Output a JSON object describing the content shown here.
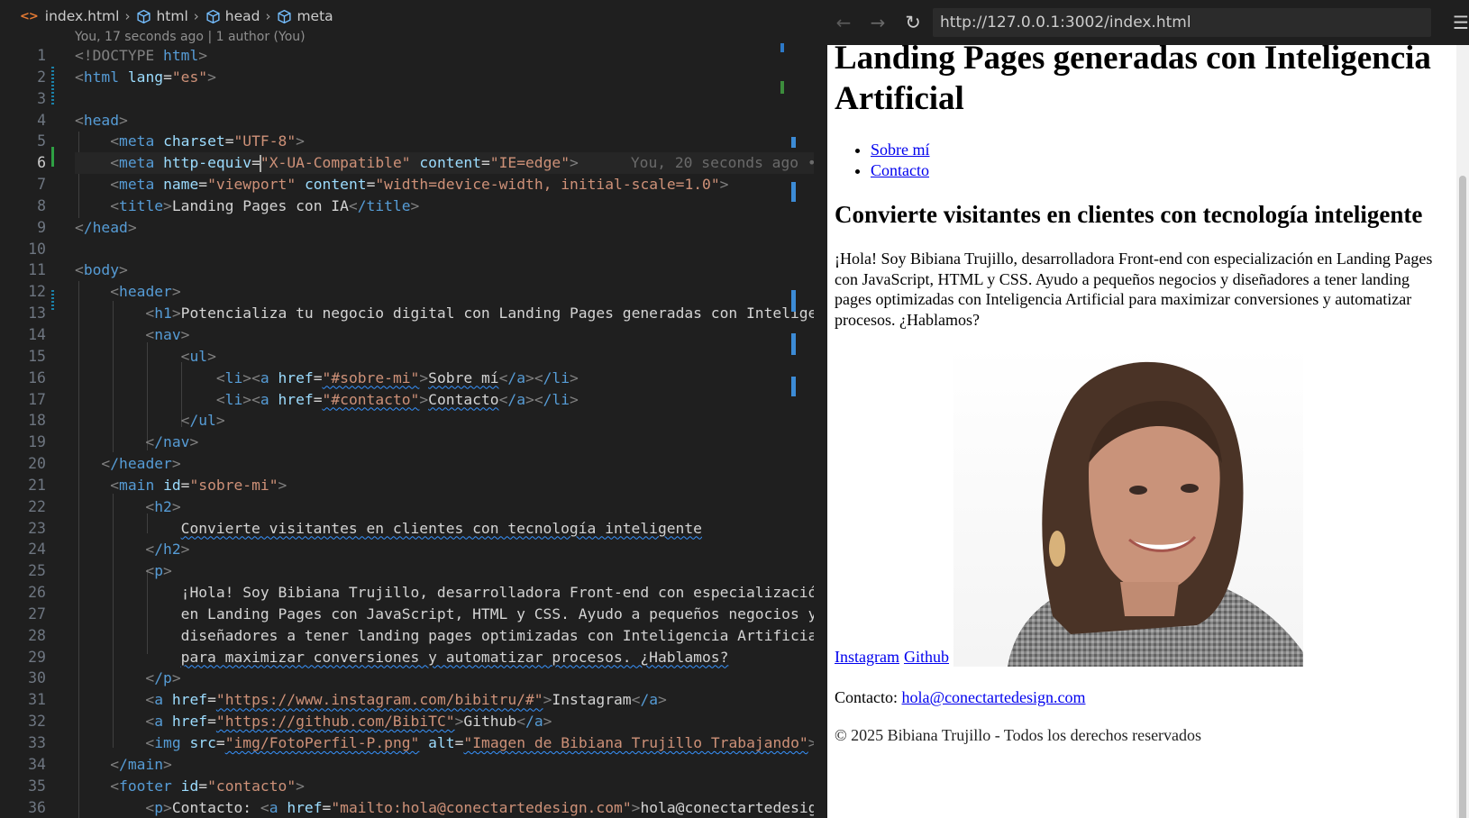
{
  "editor": {
    "breadcrumb": [
      "index.html",
      "html",
      "head",
      "meta"
    ],
    "blame": "You, 17 seconds ago | 1 author (You)",
    "line_numbers": [
      "1",
      "2",
      "3",
      "4",
      "5",
      "6",
      "7",
      "8",
      "9",
      "10",
      "11",
      "12",
      "13",
      "14",
      "15",
      "16",
      "17",
      "18",
      "19",
      "20",
      "21",
      "22",
      "23",
      "24",
      "25",
      "26",
      "27",
      "28",
      "29",
      "30",
      "31",
      "32",
      "33",
      "34",
      "35",
      "36"
    ],
    "active_line": "6",
    "inline_blame": "You, 20 seconds ago •",
    "code": {
      "l1_doctype": "<!DOCTYPE",
      "l1_html": "html",
      "l2_tag": "html",
      "l2_attr": "lang",
      "l2_val": "\"es\"",
      "l4_tag": "head",
      "l5_tag": "meta",
      "l5_attr": "charset",
      "l5_val": "\"UTF-8\"",
      "l6_tag": "meta",
      "l6_attr1": "http-equiv",
      "l6_val1": "\"X-UA-Compatible\"",
      "l6_attr2": "content",
      "l6_val2": "\"IE=edge\"",
      "l7_tag": "meta",
      "l7_attr1": "name",
      "l7_val1": "\"viewport\"",
      "l7_attr2": "content",
      "l7_val2": "\"width=device-width, initial-scale=1.0\"",
      "l8_tag": "title",
      "l8_text": "Landing Pages con IA",
      "l8_close": "/title",
      "l9_close": "/head",
      "l11_tag": "body",
      "l12_tag": "header",
      "l13_tag": "h1",
      "l13_text": "Potencializa tu negocio digital con Landing Pages generadas con Inteligencia Artificial",
      "l14_tag": "nav",
      "l15_tag": "ul",
      "l16_li": "li",
      "l16_a": "a",
      "l16_attr": "href",
      "l16_val": "\"#sobre-mi\"",
      "l16_text": "Sobre mí",
      "l16_close": "/a",
      "l16_close_li": "/li",
      "l17_li": "li",
      "l17_a": "a",
      "l17_attr": "href",
      "l17_val": "\"#contacto\"",
      "l17_text": "Contacto",
      "l17_close": "/a",
      "l17_close_li": "/li",
      "l18_close": "/ul",
      "l19_close": "/nav",
      "l20_close": "/header",
      "l21_tag": "main",
      "l21_attr": "id",
      "l21_val": "\"sobre-mi\"",
      "l22_tag": "h2",
      "l23_text": "Convierte visitantes en clientes con tecnología inteligente",
      "l24_close": "/h2",
      "l25_tag": "p",
      "l26_text": "¡Hola! Soy Bibiana Trujillo, desarrolladora Front-end con especialización",
      "l27_text": "en Landing Pages con JavaScript, HTML y CSS. Ayudo a pequeños negocios y",
      "l28_text": "diseñadores a tener landing pages optimizadas con Inteligencia Artificial",
      "l29_text": "para maximizar conversiones y automatizar procesos. ¿Hablamos?",
      "l30_close": "/p",
      "l31_tag": "a",
      "l31_attr": "href",
      "l31_val": "\"https://www.instagram.com/bibitru/#\"",
      "l31_text": "Instagram",
      "l31_close": "/a",
      "l32_tag": "a",
      "l32_attr": "href",
      "l32_val": "\"https://github.com/BibiTC\"",
      "l32_text": "Github",
      "l32_close": "/a",
      "l33_tag": "img",
      "l33_attr1": "src",
      "l33_val1": "\"img/FotoPerfil-P.png\"",
      "l33_attr2": "alt",
      "l33_val2": "\"Imagen de Bibiana Trujillo Trabajando\"",
      "l34_close": "/main",
      "l35_tag": "footer",
      "l35_attr": "id",
      "l35_val": "\"contacto\"",
      "l36_tag": "p",
      "l36_text": "Contacto: ",
      "l36_a": "a",
      "l36_attr": "href",
      "l36_val": "\"mailto:hola@conectartedesign.com\"",
      "l36_text2": "hola@conectartedesign.com"
    }
  },
  "browser": {
    "url": "http://127.0.0.1:3002/index.html",
    "icons": {
      "back": "arrow-left-icon",
      "forward": "arrow-right-icon",
      "reload": "reload-icon",
      "menu": "menu-icon"
    },
    "page": {
      "h1": "Landing Pages generadas con Inteligencia Artificial",
      "nav": [
        "Sobre mí",
        "Contacto"
      ],
      "h2": "Convierte visitantes en clientes con tecnología inteligente",
      "intro": "¡Hola! Soy Bibiana Trujillo, desarrolladora Front-end con especialización en Landing Pages con JavaScript, HTML y CSS. Ayudo a pequeños negocios y diseñadores a tener landing pages optimizadas con Inteligencia Artificial para maximizar conversiones y automatizar procesos. ¿Hablamos?",
      "links": [
        "Instagram",
        "Github"
      ],
      "contact_label": "Contacto: ",
      "contact_email": "hola@conectartedesign.com",
      "copyright": "© 2025 Bibiana Trujillo - Todos los derechos reservados"
    }
  },
  "colors": {
    "editor_bg": "#1f1f1f",
    "tag": "#569cd6",
    "attribute": "#9cdcfe",
    "string": "#ce9178",
    "link": "#0000ee"
  }
}
